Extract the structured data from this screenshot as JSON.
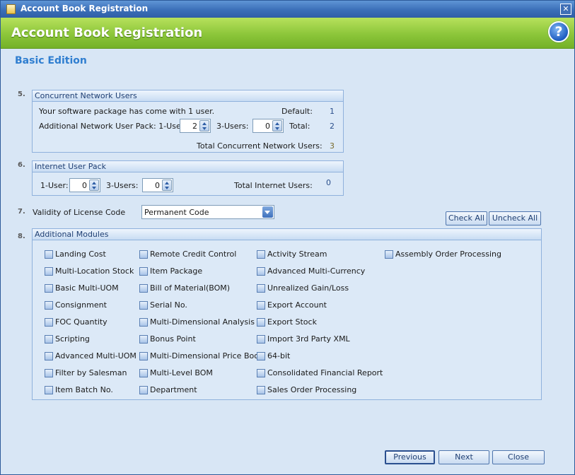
{
  "window": {
    "title": "Account Book Registration",
    "close_glyph": "✕"
  },
  "header": {
    "title": "Account Book Registration",
    "help_glyph": "?"
  },
  "edition": "Basic Edition",
  "concurrent": {
    "number": "5.",
    "title": "Concurrent Network Users",
    "intro": "Your software package has come with 1 user.",
    "default_label": "Default:",
    "default_value": "1",
    "pack_label": "Additional Network User Pack: 1-User:",
    "one_user_value": "2",
    "three_user_label": "3-Users:",
    "three_user_value": "0",
    "total_label": "Total:",
    "total_value": "2",
    "grand_total_label": "Total Concurrent Network Users:",
    "grand_total_value": "3"
  },
  "internet": {
    "number": "6.",
    "title": "Internet User Pack",
    "one_user_label": "1-User:",
    "one_user_value": "0",
    "three_user_label": "3-Users:",
    "three_user_value": "0",
    "total_label": "Total Internet Users:",
    "total_value": "0"
  },
  "license": {
    "number": "7.",
    "label": "Validity of License Code",
    "selected": "Permanent Code"
  },
  "modules": {
    "number": "8.",
    "title": "Additional Modules",
    "check_all": "Check All",
    "uncheck_all": "Uncheck All",
    "columns": [
      [
        "Landing Cost",
        "Multi-Location Stock",
        "Basic Multi-UOM",
        "Consignment",
        "FOC Quantity",
        "Scripting",
        "Advanced Multi-UOM",
        "Filter by Salesman",
        "Item Batch No."
      ],
      [
        "Remote Credit Control",
        "Item Package",
        "Bill of Material(BOM)",
        "Serial No.",
        "Multi-Dimensional Analysis",
        "Bonus Point",
        "Multi-Dimensional Price Book",
        "Multi-Level BOM",
        "Department"
      ],
      [
        "Activity Stream",
        "Advanced Multi-Currency",
        "Unrealized Gain/Loss",
        "Export Account",
        "Export Stock",
        "Import 3rd Party XML",
        "64-bit",
        "Consolidated Financial Report",
        "Sales Order Processing"
      ],
      [
        "Assembly Order Processing"
      ]
    ]
  },
  "footer": {
    "previous": "Previous",
    "next": "Next",
    "close": "Close"
  }
}
